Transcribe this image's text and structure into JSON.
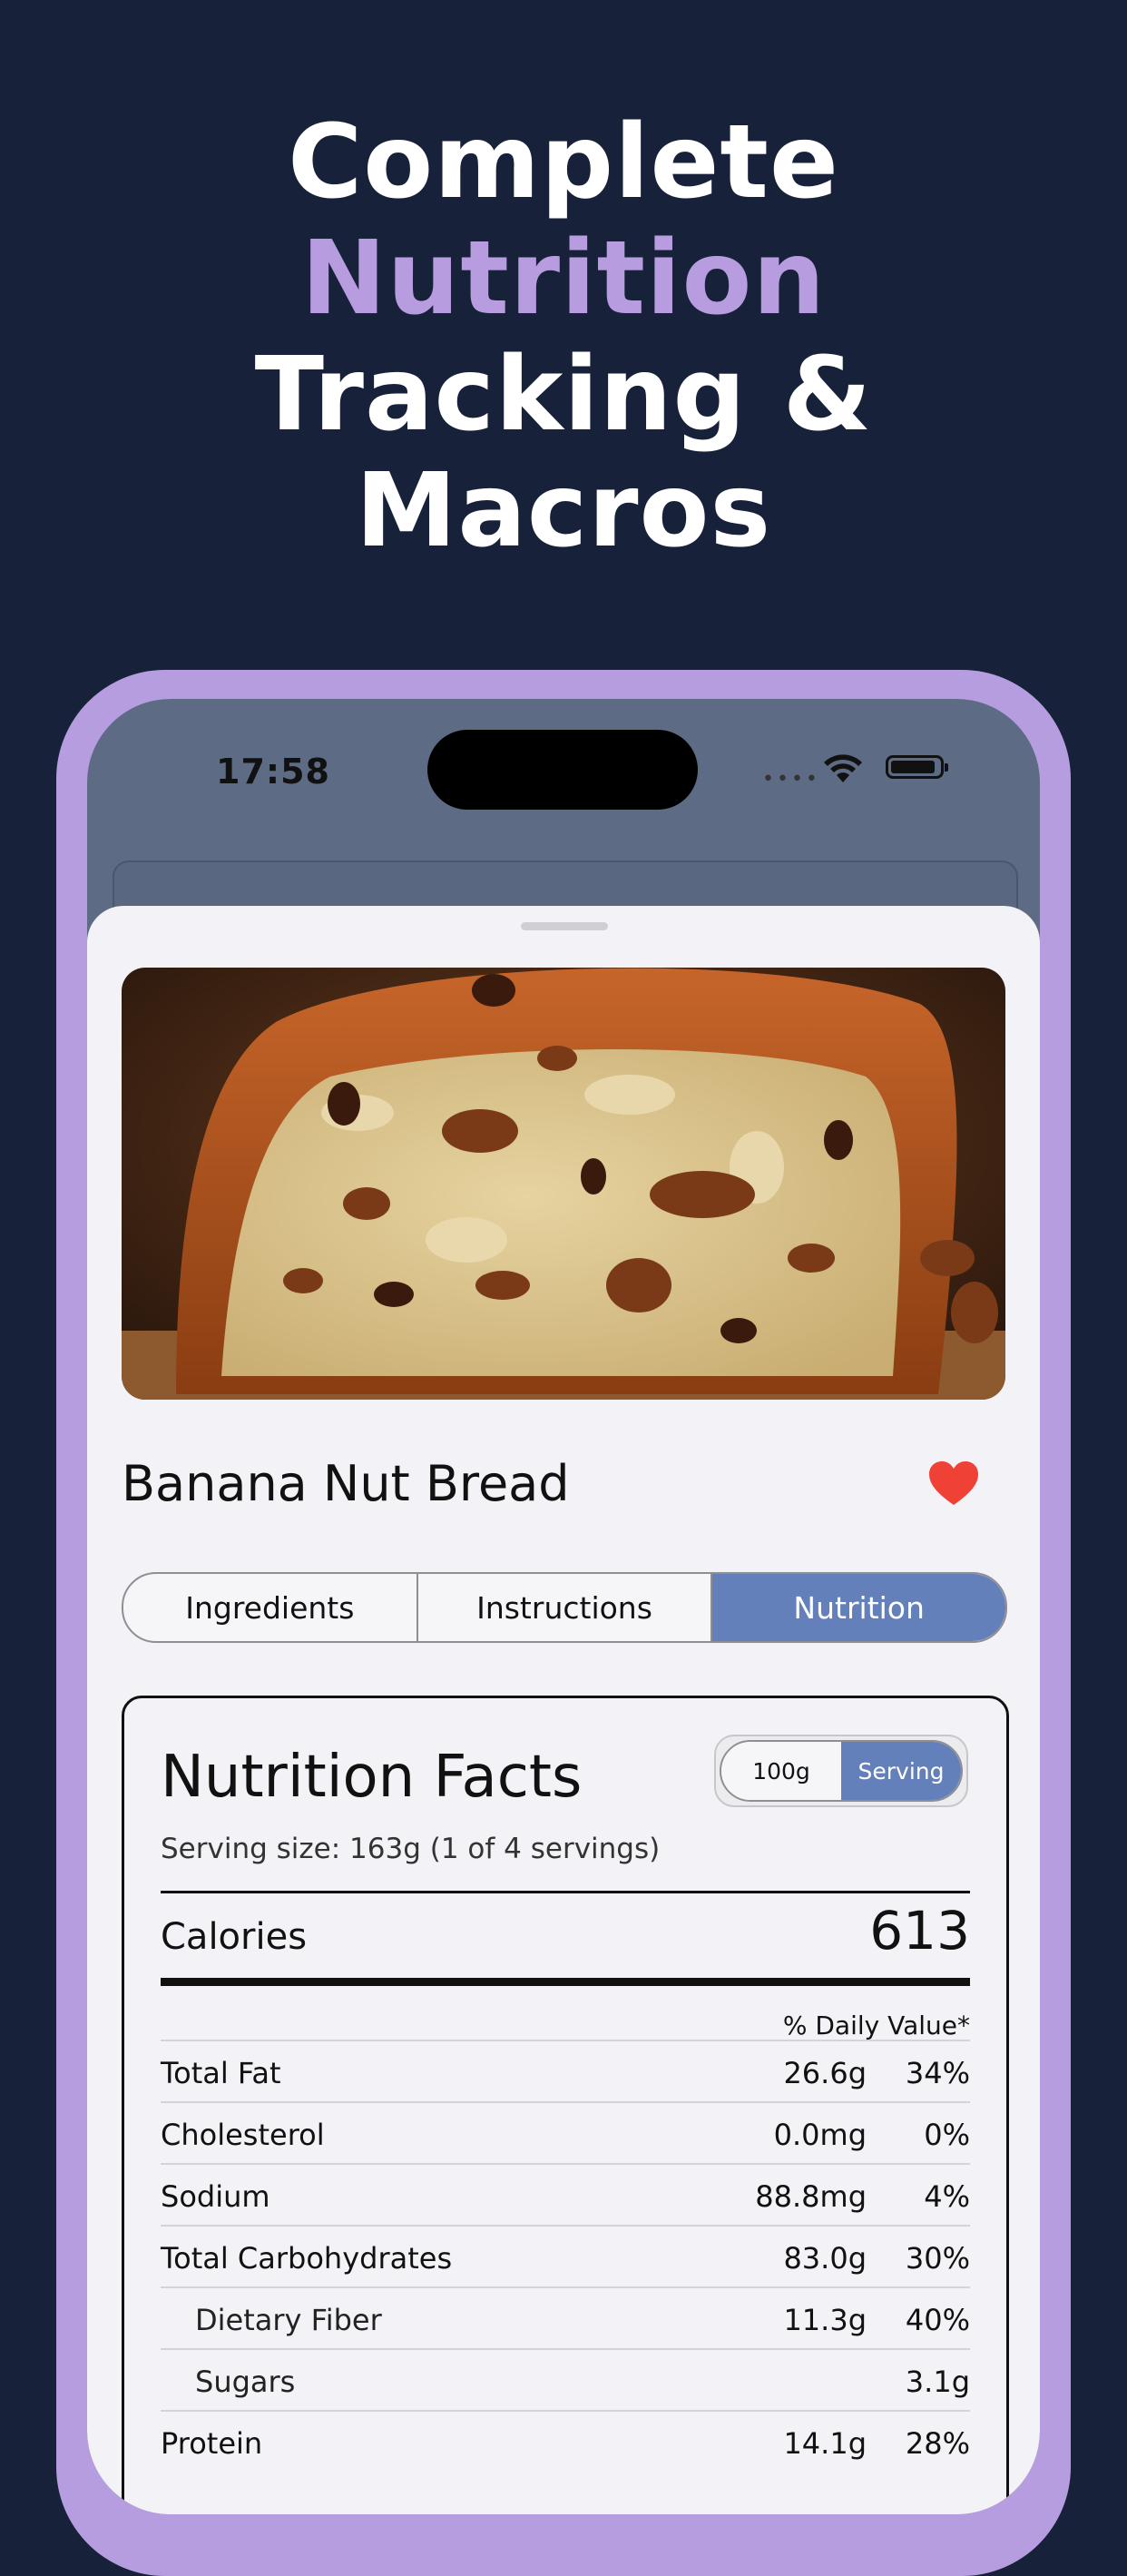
{
  "headline": {
    "line1": "Complete",
    "line2": "Nutrition",
    "line3": "Tracking &",
    "line4": "Macros"
  },
  "colors": {
    "background": "#17223a",
    "accent": "#b79de0",
    "tab_active": "#6480ba",
    "heart": "#ef4136"
  },
  "status_bar": {
    "time": "17:58"
  },
  "recipe": {
    "title": "Banana Nut Bread",
    "favorite_icon": "heart-icon"
  },
  "tabs": [
    {
      "label": "Ingredients",
      "active": false
    },
    {
      "label": "Instructions",
      "active": false
    },
    {
      "label": "Nutrition",
      "active": true
    }
  ],
  "nutrition": {
    "title": "Nutrition Facts",
    "unit_toggle": [
      "100g",
      "Serving"
    ],
    "serving_size": "Serving size: 163g (1 of 4 servings)",
    "calories_label": "Calories",
    "calories_value": "613",
    "daily_value_header": "% Daily Value*",
    "rows": [
      {
        "label": "Total Fat",
        "amount": "26.6g",
        "percent": "34%"
      },
      {
        "label": "Cholesterol",
        "amount": "0.0mg",
        "percent": "0%"
      },
      {
        "label": "Sodium",
        "amount": "88.8mg",
        "percent": "4%"
      },
      {
        "label": "Total Carbohydrates",
        "amount": "83.0g",
        "percent": "30%"
      },
      {
        "label": "Dietary Fiber",
        "amount": "11.3g",
        "percent": "40%"
      },
      {
        "label": "Sugars",
        "amount": "",
        "percent": "3.1g"
      },
      {
        "label": "Protein",
        "amount": "14.1g",
        "percent": "28%"
      }
    ]
  }
}
